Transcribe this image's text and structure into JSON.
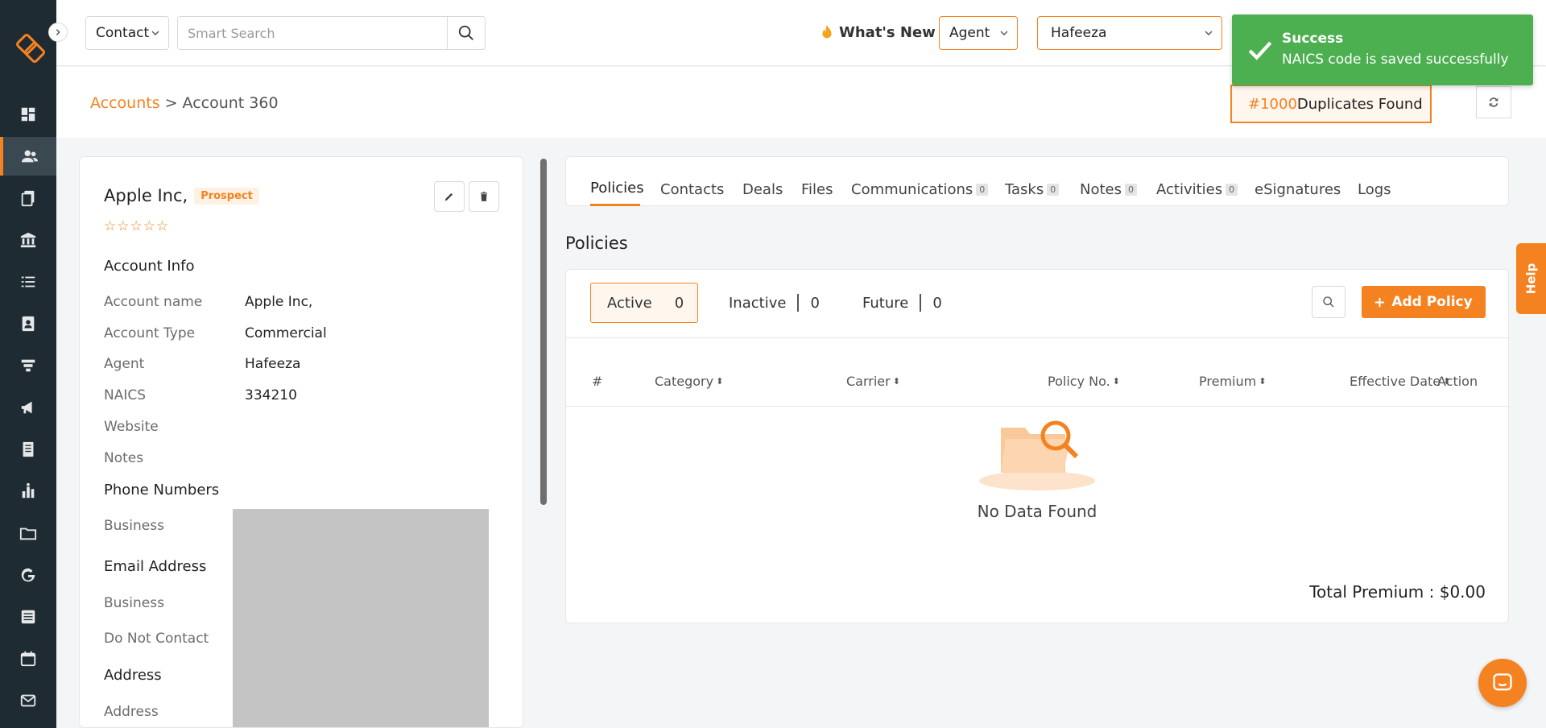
{
  "topbar": {
    "module_select": "Contact",
    "search_placeholder": "Smart Search",
    "whats_new": "What's New",
    "role_select": "Agent",
    "user_select": "Hafeeza"
  },
  "toast": {
    "title": "Success",
    "message": "NAICS code is saved successfully"
  },
  "breadcrumb": {
    "parent": "Accounts",
    "separator": ">",
    "current": "Account 360"
  },
  "duplicates": {
    "count": "#1000",
    "label": "Duplicates Found"
  },
  "account": {
    "name": "Apple Inc,",
    "status": "Prospect",
    "stars": "☆☆☆☆☆",
    "sections": {
      "account_info": "Account Info",
      "phone_numbers": "Phone Numbers",
      "email_address": "Email Address",
      "address": "Address"
    },
    "fields": [
      {
        "label": "Account name",
        "value": "Apple Inc,"
      },
      {
        "label": "Account Type",
        "value": "Commercial"
      },
      {
        "label": "Agent",
        "value": "Hafeeza"
      },
      {
        "label": "NAICS",
        "value": "334210"
      },
      {
        "label": "Website",
        "value": ""
      },
      {
        "label": "Notes",
        "value": ""
      }
    ],
    "phone_label": "Business",
    "email_label": "Business",
    "do_not_contact_label": "Do Not Contact",
    "address_label": "Address"
  },
  "tabs": [
    {
      "label": "Policies",
      "count": null
    },
    {
      "label": "Contacts",
      "count": null
    },
    {
      "label": "Deals",
      "count": null
    },
    {
      "label": "Files",
      "count": null
    },
    {
      "label": "Communications",
      "count": "0"
    },
    {
      "label": "Tasks",
      "count": "0"
    },
    {
      "label": "Notes",
      "count": "0"
    },
    {
      "label": "Activities",
      "count": "0"
    },
    {
      "label": "eSignatures",
      "count": null
    },
    {
      "label": "Logs",
      "count": null
    }
  ],
  "policies": {
    "heading": "Policies",
    "filters": [
      {
        "label": "Active",
        "count": "0"
      },
      {
        "label": "Inactive",
        "count": "0"
      },
      {
        "label": "Future",
        "count": "0"
      }
    ],
    "add_button": "Add Policy",
    "columns": [
      "#",
      "Category",
      "Carrier",
      "Policy No.",
      "Premium",
      "Effective Date",
      "Action"
    ],
    "empty_text": "No Data Found",
    "total_label": "Total Premium : $0.00"
  },
  "help_label": "Help",
  "colors": {
    "accent": "#f58220",
    "sidebar": "#1f2b33",
    "success": "#4caf50"
  }
}
